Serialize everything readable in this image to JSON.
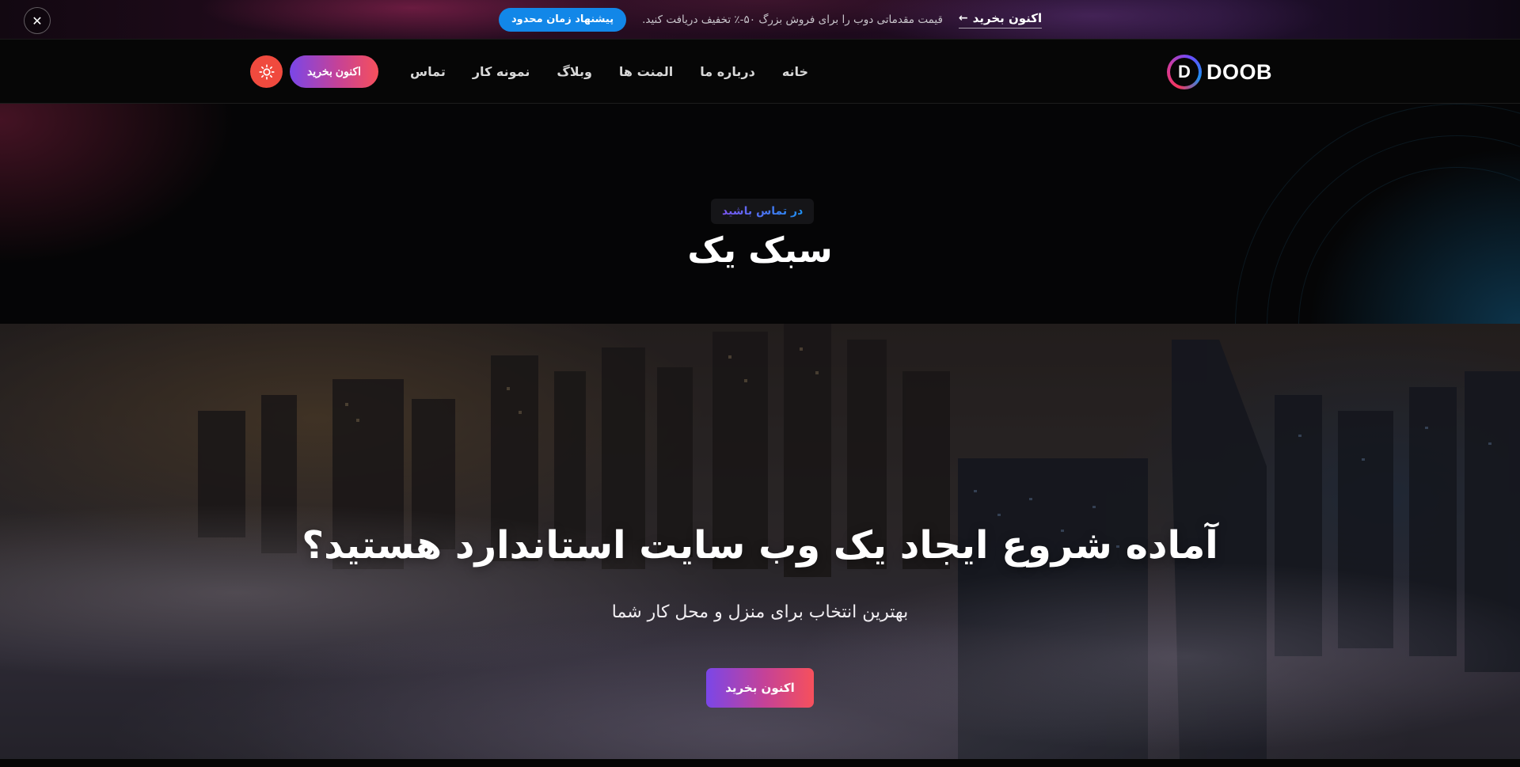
{
  "promo": {
    "badge": "پیشنهاد زمان محدود",
    "text": "قیمت مقدماتی دوب را برای فروش بزرگ ۵۰-٪ تخفیف دریافت کنید.",
    "link_label": "اکنون بخرید",
    "link_arrow": "←",
    "close_icon": "✕"
  },
  "header": {
    "logo_letter": "D",
    "logo_text": "DOOB",
    "nav": [
      "خانه",
      "درباره ما",
      "المنت ها",
      "وبلاگ",
      "نمونه کار",
      "تماس"
    ],
    "buy_label": "اکنون بخرید",
    "theme_icon": "sun-icon"
  },
  "title_area": {
    "subtitle": "در تماس باشید",
    "title": "سبک یک"
  },
  "hero": {
    "heading": "آماده شروع ایجاد یک وب سایت استاندارد هستید؟",
    "subheading": "بهترین انتخاب برای منزل و محل کار شما",
    "cta_label": "اکنون بخرید"
  },
  "colors": {
    "accent_blue": "#1287e8",
    "gradient_start": "#7a46e8",
    "gradient_end": "#f6505c",
    "theme_toggle": "#f04a3e"
  }
}
